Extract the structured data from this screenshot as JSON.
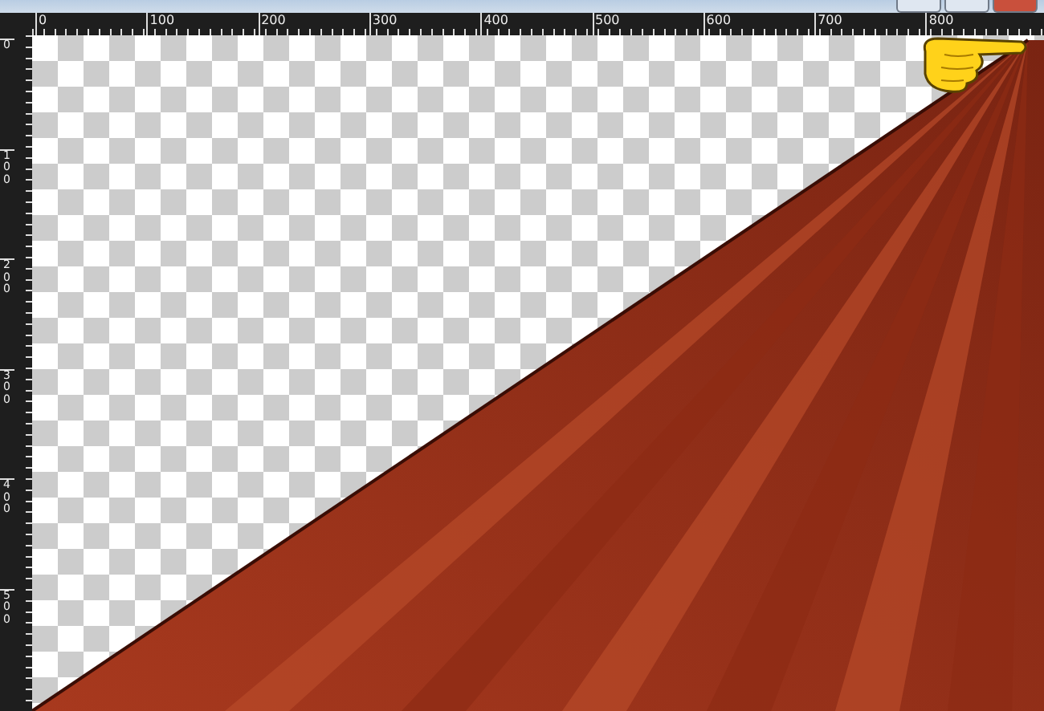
{
  "horizontal_ruler": {
    "labels": [
      "0",
      "100",
      "200",
      "300",
      "400",
      "500",
      "600",
      "700",
      "800"
    ]
  },
  "vertical_ruler": {
    "labels": [
      "0",
      "100",
      "200",
      "300",
      "400",
      "500"
    ]
  }
}
